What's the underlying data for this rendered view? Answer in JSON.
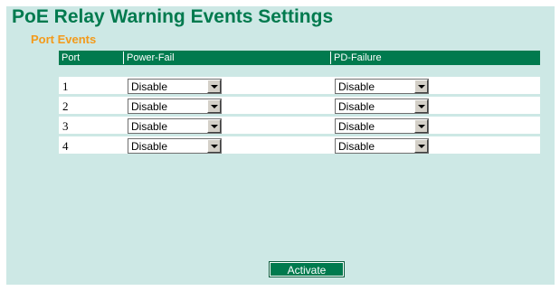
{
  "page": {
    "title": "PoE Relay Warning Events Settings",
    "subtitle": "Port Events"
  },
  "table": {
    "headers": [
      "Port",
      "Power-Fail",
      "PD-Failure"
    ],
    "rows": [
      {
        "port": "1",
        "power_fail": "Disable",
        "pd_failure": "Disable"
      },
      {
        "port": "2",
        "power_fail": "Disable",
        "pd_failure": "Disable"
      },
      {
        "port": "3",
        "power_fail": "Disable",
        "pd_failure": "Disable"
      },
      {
        "port": "4",
        "power_fail": "Disable",
        "pd_failure": "Disable"
      }
    ]
  },
  "actions": {
    "activate_label": "Activate"
  },
  "colors": {
    "background": "#cde8e5",
    "header": "#007a4e",
    "title": "#007a4e",
    "subtitle": "#f39a1a"
  }
}
